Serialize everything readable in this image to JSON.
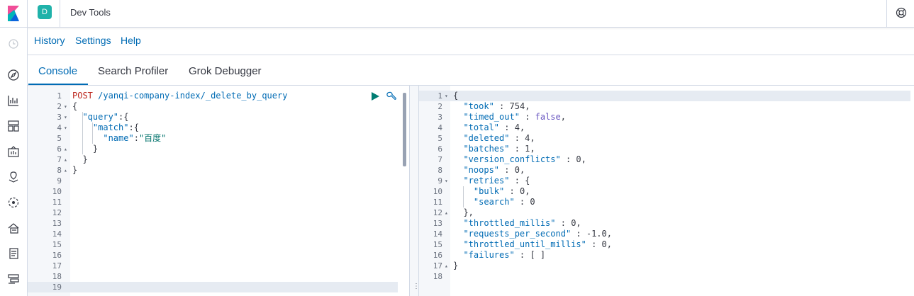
{
  "header": {
    "space_initial": "D",
    "title": "Dev Tools"
  },
  "menu": {
    "history": "History",
    "settings": "Settings",
    "help": "Help"
  },
  "tabs": [
    "Console",
    "Search Profiler",
    "Grok Debugger"
  ],
  "icons": {
    "logo": "kibana-logo-icon",
    "help": "help-lifebuoy-icon",
    "run": "play-icon",
    "settings": "wrench-icon"
  },
  "colors": {
    "accent": "#006bb4",
    "space_avatar": "#20b2aa",
    "method": "#bd271e",
    "string": "#00726b"
  },
  "request": {
    "method": "POST",
    "path": "/yanqi-company-index/_delete_by_query",
    "lines": [
      "{",
      "  \"query\":{",
      "    \"match\":{",
      "      \"name\":\"百度\"",
      "    }",
      "  }",
      "}"
    ],
    "line_numbers": [
      "1",
      "2",
      "3",
      "4",
      "5",
      "6",
      "7",
      "8",
      "9",
      "10",
      "11",
      "12",
      "13",
      "14",
      "15",
      "16",
      "17",
      "18",
      "19"
    ]
  },
  "response": {
    "lines": [
      "{",
      "  \"took\" : 754,",
      "  \"timed_out\" : false,",
      "  \"total\" : 4,",
      "  \"deleted\" : 4,",
      "  \"batches\" : 1,",
      "  \"version_conflicts\" : 0,",
      "  \"noops\" : 0,",
      "  \"retries\" : {",
      "    \"bulk\" : 0,",
      "    \"search\" : 0",
      "  },",
      "  \"throttled_millis\" : 0,",
      "  \"requests_per_second\" : -1.0,",
      "  \"throttled_until_millis\" : 0,",
      "  \"failures\" : [ ]",
      "}",
      ""
    ],
    "line_numbers": [
      "1",
      "2",
      "3",
      "4",
      "5",
      "6",
      "7",
      "8",
      "9",
      "10",
      "11",
      "12",
      "13",
      "14",
      "15",
      "16",
      "17",
      "18"
    ]
  }
}
